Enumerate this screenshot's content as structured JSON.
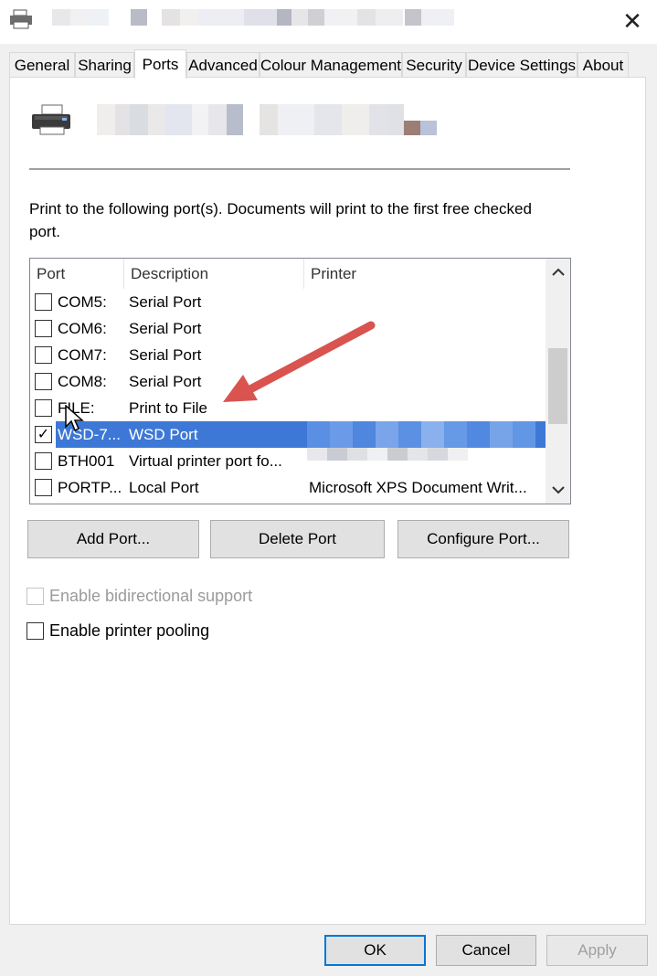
{
  "window": {
    "close_glyph": "✕"
  },
  "tabs": [
    {
      "label": "General"
    },
    {
      "label": "Sharing"
    },
    {
      "label": "Ports"
    },
    {
      "label": "Advanced"
    },
    {
      "label": "Colour Management"
    },
    {
      "label": "Security"
    },
    {
      "label": "Device Settings"
    },
    {
      "label": "About"
    }
  ],
  "active_tab": "Ports",
  "instructions": "Print to the following port(s). Documents will print to the first free checked port.",
  "port_list": {
    "columns": [
      "Port",
      "Description",
      "Printer"
    ],
    "rows": [
      {
        "port": "COM5:",
        "description": "Serial Port",
        "printer": "",
        "checked": false,
        "selected": false
      },
      {
        "port": "COM6:",
        "description": "Serial Port",
        "printer": "",
        "checked": false,
        "selected": false
      },
      {
        "port": "COM7:",
        "description": "Serial Port",
        "printer": "",
        "checked": false,
        "selected": false
      },
      {
        "port": "COM8:",
        "description": "Serial Port",
        "printer": "",
        "checked": false,
        "selected": false
      },
      {
        "port": "FILE:",
        "description": "Print to File",
        "printer": "",
        "checked": false,
        "selected": false
      },
      {
        "port": "WSD-7...",
        "description": "WSD Port",
        "printer": "",
        "checked": true,
        "selected": true
      },
      {
        "port": "BTH001",
        "description": "Virtual printer port fo...",
        "printer": "",
        "checked": false,
        "selected": false
      },
      {
        "port": "PORTP...",
        "description": "Local Port",
        "printer": "Microsoft XPS Document Writ...",
        "checked": false,
        "selected": false
      }
    ]
  },
  "port_buttons": {
    "add": "Add Port...",
    "delete": "Delete Port",
    "configure": "Configure Port..."
  },
  "options": {
    "bidirectional": {
      "label": "Enable bidirectional support",
      "checked": false,
      "enabled": false
    },
    "pooling": {
      "label": "Enable printer pooling",
      "checked": false,
      "enabled": true
    }
  },
  "dialog_buttons": {
    "ok": "OK",
    "cancel": "Cancel",
    "apply": "Apply"
  },
  "colors": {
    "selection": "#3d78d6",
    "annotation_arrow": "#d9534f",
    "default_button_border": "#0078d7"
  }
}
